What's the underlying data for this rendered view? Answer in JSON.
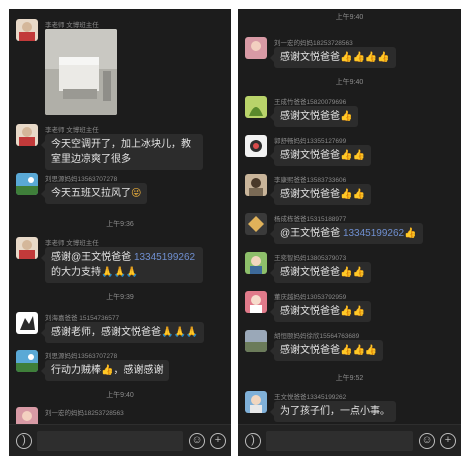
{
  "left": {
    "messages": [
      {
        "name": "李老师  文博班主任",
        "image": "photo"
      },
      {
        "name": "李老师  文博班主任",
        "text": "今天空调开了，加上冰块儿，教室里边凉爽了很多"
      },
      {
        "name": "刘思源妈妈13563707278",
        "text": "今天五班又拉风了",
        "emoji": "😜"
      },
      {
        "timestamp": "上午9:36"
      },
      {
        "name": "李老师  文博班主任",
        "text": "感谢@王文悦爸爸 ",
        "phone": "13345199262",
        "text2": "的大力支持",
        "emoji": "🙏🙏🙏"
      },
      {
        "timestamp": "上午9:39"
      },
      {
        "name": "刘海嘉爸爸  15154736577",
        "text": "感谢老师，感谢文悦爸爸",
        "emoji": "🙏🙏🙏"
      },
      {
        "name": "刘思源妈妈13563707278",
        "text": "行动力贼棒",
        "emoji": "👍",
        "text2": "，感谢感谢"
      },
      {
        "timestamp": "上午9:40"
      },
      {
        "name": "刘一宏的妈妈18253728563"
      }
    ]
  },
  "right": {
    "messages": [
      {
        "timestamp": "上午9:40"
      },
      {
        "name": "刘一宏的妈妈18253728563",
        "text": "感谢文悦爸爸",
        "emoji": "👍👍👍👍"
      },
      {
        "timestamp": "上午9:40"
      },
      {
        "name": "王成竹爸爸15820079696",
        "text": "感谢文悦爸爸",
        "emoji": "👍"
      },
      {
        "name": "郭舒畅妈妈13355127699",
        "text": "感谢文悦爸爸",
        "emoji": "👍👍"
      },
      {
        "name": "李康熙爸爸13583733606",
        "text": "感谢文悦爸爸",
        "emoji": "👍👍"
      },
      {
        "name": "杨成栋爸爸15315188977",
        "text": "@王文悦爸爸 ",
        "phone": "13345199262",
        "emoji": "👍"
      },
      {
        "name": "王奕智妈妈13805379073",
        "text": "感谢文悦爸爸",
        "emoji": "👍👍"
      },
      {
        "name": "董庆越妈妈13053792959",
        "text": "感谢文悦爸爸",
        "emoji": "👍👍"
      },
      {
        "name": "胡恒颐妈妈徐欣15564763689",
        "text": "感谢文悦爸爸",
        "emoji": "👍👍👍"
      },
      {
        "timestamp": "上午9:52"
      },
      {
        "name": "王文悦爸爸13345199262",
        "text": "为了孩子们，一点小事。"
      }
    ]
  },
  "input_bar": {
    "voice_icon": "voice-icon",
    "emoji_icon": "emoji-icon",
    "plus_icon": "plus-icon"
  },
  "colors": {
    "background": "#1c1c1c",
    "bubble": "#2c2c2c",
    "text": "#e4e4e4",
    "link": "#6f8fd0"
  }
}
